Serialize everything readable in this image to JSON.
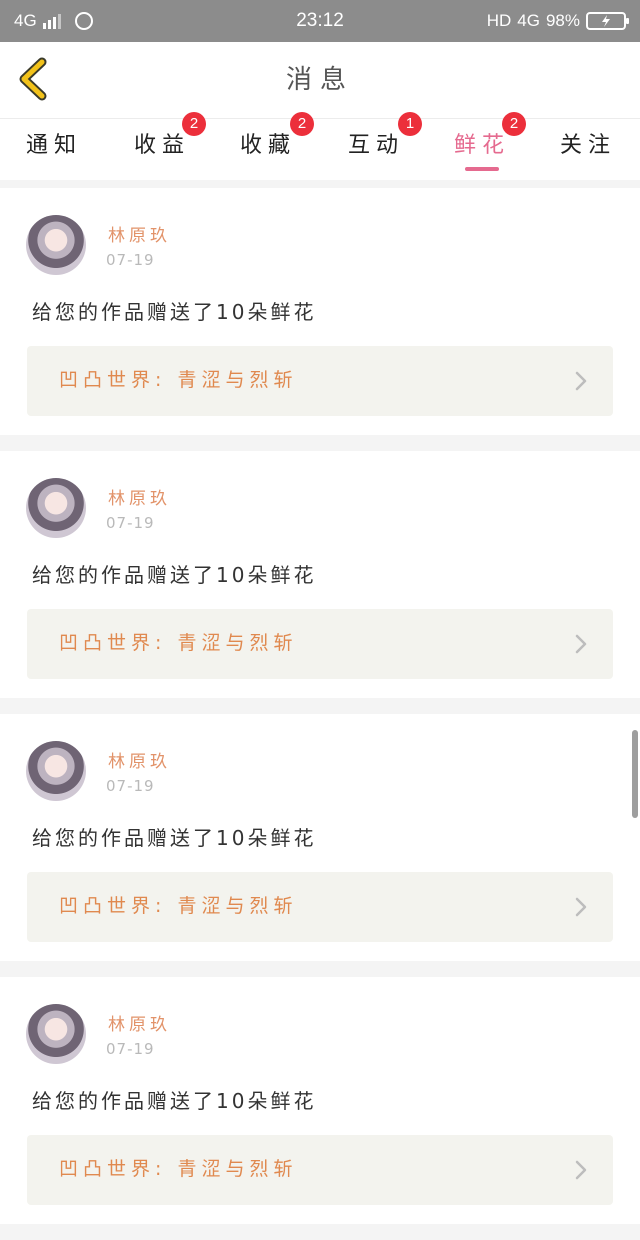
{
  "status_bar": {
    "network_left": "4G",
    "time": "23:12",
    "hd": "HD",
    "network_right": "4G",
    "battery": "98%",
    "charging_icon": "bolt-icon"
  },
  "header": {
    "title": "消息",
    "back_icon": "chevron-left-icon",
    "accent_color": "#f2c21a"
  },
  "tabs": [
    {
      "label": "通知",
      "badge": ""
    },
    {
      "label": "收益",
      "badge": "2"
    },
    {
      "label": "收藏",
      "badge": "2"
    },
    {
      "label": "互动",
      "badge": "1"
    },
    {
      "label": "鲜花",
      "badge": "2",
      "active": true
    },
    {
      "label": "关注",
      "badge": ""
    }
  ],
  "colors": {
    "active_tab": "#e56a8f",
    "badge": "#ec2f3b",
    "sender": "#e2936a",
    "work_link": "#e0894f"
  },
  "messages": [
    {
      "sender": "林原玖",
      "date": "07-19",
      "text": "给您的作品赠送了10朵鲜花",
      "work": "凹凸世界:  青涩与烈斩"
    },
    {
      "sender": "林原玖",
      "date": "07-19",
      "text": "给您的作品赠送了10朵鲜花",
      "work": "凹凸世界:  青涩与烈斩"
    },
    {
      "sender": "林原玖",
      "date": "07-19",
      "text": "给您的作品赠送了10朵鲜花",
      "work": "凹凸世界:  青涩与烈斩"
    },
    {
      "sender": "林原玖",
      "date": "07-19",
      "text": "给您的作品赠送了10朵鲜花",
      "work": "凹凸世界:  青涩与烈斩"
    }
  ]
}
